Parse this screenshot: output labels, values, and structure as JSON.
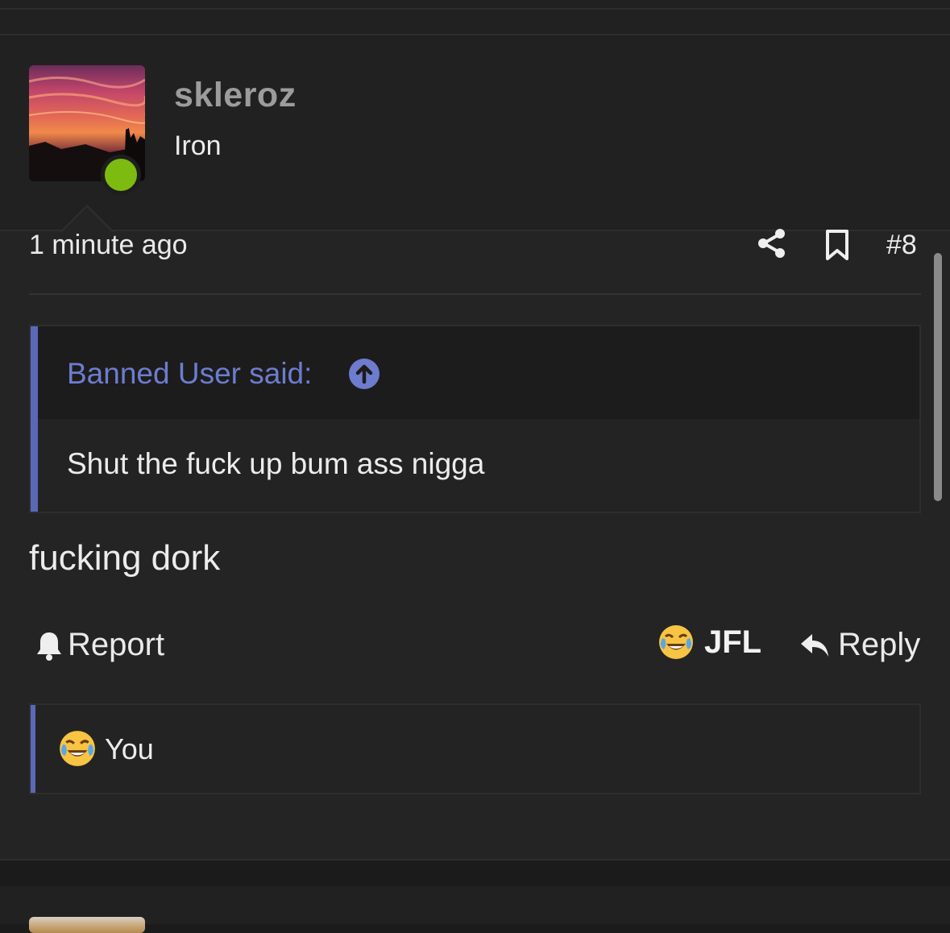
{
  "post": {
    "username": "skleroz",
    "user_title": "Iron",
    "status": "online",
    "timestamp": "1 minute ago",
    "post_number": "#8",
    "quote": {
      "author": "Banned User said:",
      "text": "Shut the fuck up bum ass nigga"
    },
    "message": "fucking dork",
    "actions": {
      "report": "Report",
      "reaction": "JFL",
      "reply": "Reply"
    },
    "reactions_summary": {
      "emoji": "face-with-tears-of-joy",
      "text": "You"
    }
  },
  "colors": {
    "background": "#242424",
    "header_background": "#212121",
    "quote_accent": "#5b68b8",
    "quote_author": "#6e7cce",
    "online_status": "#7dbb10",
    "username": "#9c9c9c"
  }
}
